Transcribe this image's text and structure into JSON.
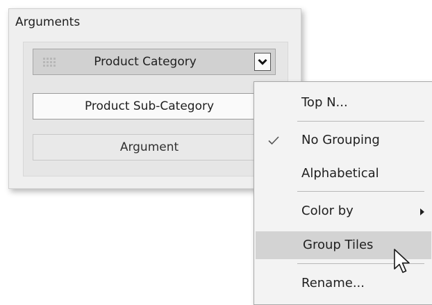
{
  "panel": {
    "title": "Arguments",
    "items": [
      {
        "label": "Product Category",
        "selected": true
      },
      {
        "label": "Product Sub-Category",
        "selected": false
      },
      {
        "label": "Argument",
        "placeholder": true
      }
    ]
  },
  "icons": {
    "grip": "drag-grip-icon",
    "dropdown": "chevron-down-icon",
    "check": "check-icon",
    "submenu": "submenu-arrow-icon",
    "cursor": "mouse-pointer-icon"
  },
  "menu": {
    "items": [
      {
        "label": "Top N..."
      },
      {
        "label": "No Grouping",
        "checked": true
      },
      {
        "label": "Alphabetical"
      },
      {
        "label": "Color by",
        "has_submenu": true
      },
      {
        "label": "Group Tiles",
        "hovered": true
      },
      {
        "label": "Rename..."
      }
    ]
  },
  "colors": {
    "selected_item_bg": "#d1d1d1",
    "menu_hover_bg": "#d3d3d3",
    "menu_bg": "#f3f3f3",
    "panel_bg": "#efefef"
  }
}
